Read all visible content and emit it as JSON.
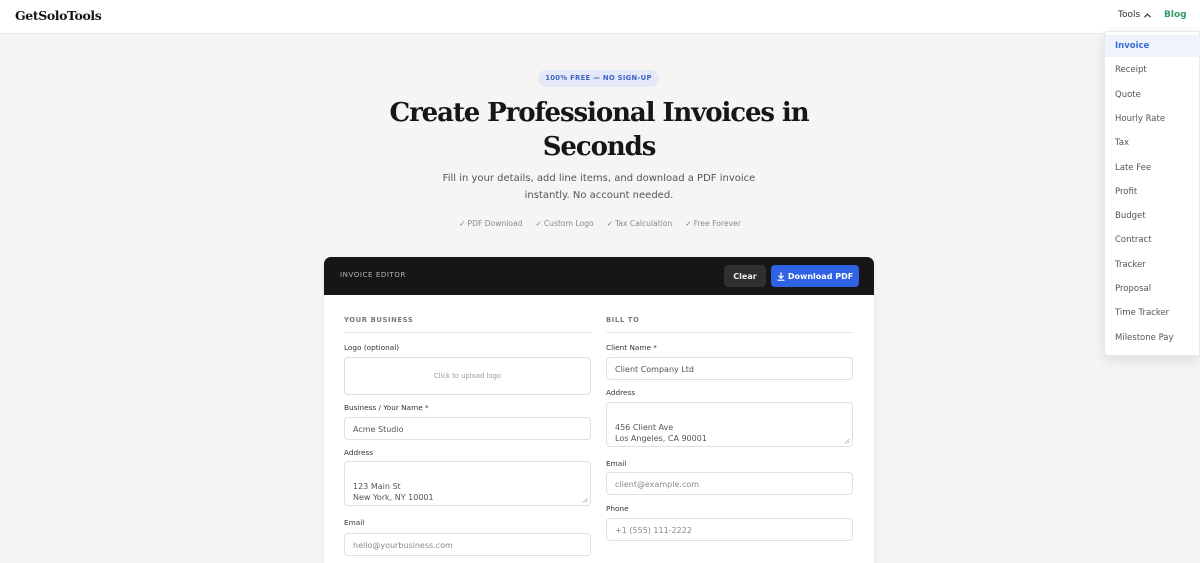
{
  "nav": {
    "logo": "GetSoloTools",
    "tools_label": "Tools",
    "blog_label": "Blog"
  },
  "dropdown": {
    "items": [
      "Invoice",
      "Receipt",
      "Quote",
      "Hourly Rate",
      "Tax",
      "Late Fee",
      "Profit",
      "Budget",
      "Contract",
      "Tracker",
      "Proposal",
      "Time Tracker",
      "Milestone Pay"
    ],
    "active": "Invoice"
  },
  "hero": {
    "badge": "100% FREE — NO SIGN-UP",
    "title": "Create Professional Invoices in Seconds",
    "subtitle": "Fill in your details, add line items, and download a PDF invoice instantly. No account needed.",
    "features": [
      "PDF Download",
      "Custom Logo",
      "Tax Calculation",
      "Free Forever"
    ]
  },
  "editor": {
    "label": "INVOICE EDITOR",
    "clear_label": "Clear",
    "download_label": "Download PDF",
    "business": {
      "section_title": "YOUR BUSINESS",
      "logo_label": "Logo (optional)",
      "logo_upload_text": "Click to upload logo",
      "name_label": "Business / Your Name *",
      "name_value": "Acme Studio",
      "address_label": "Address",
      "address_value": "123 Main St\nNew York, NY 10001",
      "email_label": "Email",
      "email_placeholder": "hello@yourbusiness.com"
    },
    "bill_to": {
      "section_title": "BILL TO",
      "client_label": "Client Name *",
      "client_value": "Client Company Ltd",
      "address_label": "Address",
      "address_value": "456 Client Ave\nLos Angeles, CA 90001",
      "email_label": "Email",
      "email_placeholder": "client@example.com",
      "phone_label": "Phone",
      "phone_placeholder": "+1 (555) 111-2222"
    }
  },
  "colors": {
    "accent_blue": "#2f63e3",
    "blog_green": "#2d9c63",
    "editor_header": "#161616",
    "background": "#f6f5f3"
  }
}
